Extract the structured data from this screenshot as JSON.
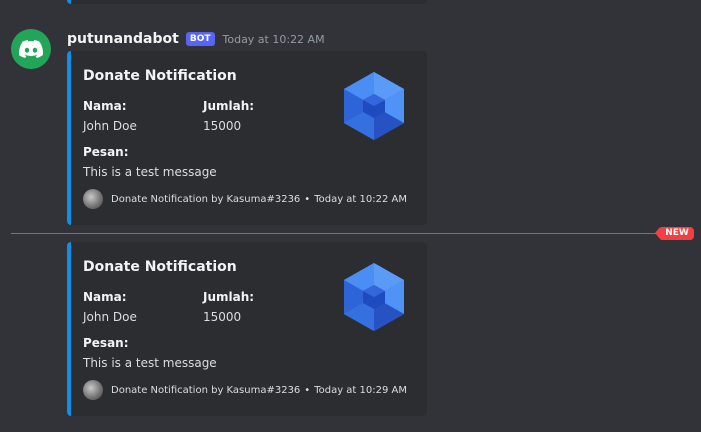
{
  "message": {
    "username": "putunandabot",
    "bot_tag": "BOT",
    "timestamp": "Today at 10:22 AM",
    "avatar_icon": "discord-logo-icon",
    "avatar_color": "#23a559"
  },
  "embeds": [
    {
      "title": "Donate Notification",
      "fields": [
        {
          "name": "Nama:",
          "value": "John Doe"
        },
        {
          "name": "Jumlah:",
          "value": "15000"
        },
        {
          "name": "Pesan:",
          "value": "This is a test message"
        }
      ],
      "thumbnail_icon": "hexagon-logo-icon",
      "footer": {
        "text": "Donate Notification by Kasuma#3236",
        "separator": "•",
        "time": "Today at 10:22 AM",
        "icon": "avatar-icon"
      }
    },
    {
      "title": "Donate Notification",
      "fields": [
        {
          "name": "Nama:",
          "value": "John Doe"
        },
        {
          "name": "Jumlah:",
          "value": "15000"
        },
        {
          "name": "Pesan:",
          "value": "This is a test message"
        }
      ],
      "thumbnail_icon": "hexagon-logo-icon",
      "footer": {
        "text": "Donate Notification by Kasuma#3236",
        "separator": "•",
        "time": "Today at 10:29 AM",
        "icon": "avatar-icon"
      }
    }
  ],
  "new_divider": {
    "label": "NEW",
    "color": "#f23f43"
  },
  "colors": {
    "background": "#313338",
    "embed_background": "#2b2d31",
    "embed_accent": "#0f8fe8",
    "bot_tag": "#5865f2"
  }
}
